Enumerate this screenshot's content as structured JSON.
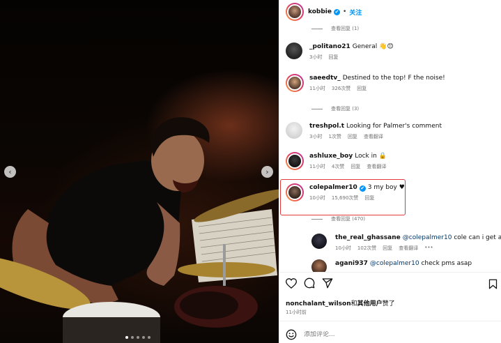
{
  "post": {
    "author": "kobbie",
    "verified_mark": "✔",
    "separator": "•",
    "follow_label": "关注",
    "image_nav": {
      "prev": "‹",
      "next": "›",
      "dots": 5,
      "active_dot": 0
    }
  },
  "comments": [
    {
      "view_replies": "查看回复 (1)"
    },
    {
      "user": "_politano21",
      "text": "General 👋😊",
      "time": "3小时",
      "reply": "回复"
    },
    {
      "user": "saeedtv_",
      "text": "Destined to the top! F the noise!",
      "time": "11小时",
      "likes": "326次赞",
      "reply": "回复",
      "view_replies": "查看回复 (3)"
    },
    {
      "user": "treshpol.t",
      "text": "Looking for Palmer's comment",
      "time": "3小时",
      "likes": "1次赞",
      "reply": "回复",
      "translate": "查看翻译"
    },
    {
      "user": "ashluxe_boy",
      "text": "Lock in 🔒",
      "time": "11小时",
      "likes": "4次赞",
      "reply": "回复",
      "translate": "查看翻译"
    },
    {
      "user": "colepalmer10",
      "verified": true,
      "text": "3 my boy ♥",
      "time": "10小时",
      "likes": "15,690次赞",
      "reply": "回复",
      "view_replies": "查看回复 (470)"
    }
  ],
  "replies": [
    {
      "user": "the_real_ghassane",
      "mention": "@colepalmer10",
      "text": "cole can i get a hi",
      "time": "10小时",
      "likes": "102次赞",
      "reply": "回复",
      "translate": "查看翻译",
      "more": "•••"
    },
    {
      "user": "agani937",
      "mention": "@colepalmer10",
      "text": "check pms asap"
    }
  ],
  "likes_line": {
    "users": "nonchalant_wilson",
    "connector": "和",
    "others": "其他用户",
    "suffix": "赞了"
  },
  "post_time": "11小时前",
  "add_comment_placeholder": "添加评论...",
  "icons": [
    "heart-icon",
    "comment-icon",
    "share-icon",
    "bookmark-icon",
    "emoji-icon",
    "verified-icon"
  ],
  "colors": {
    "accent": "#0095f6",
    "highlight_box": "#e03a3a",
    "meta_gray": "#737373"
  }
}
